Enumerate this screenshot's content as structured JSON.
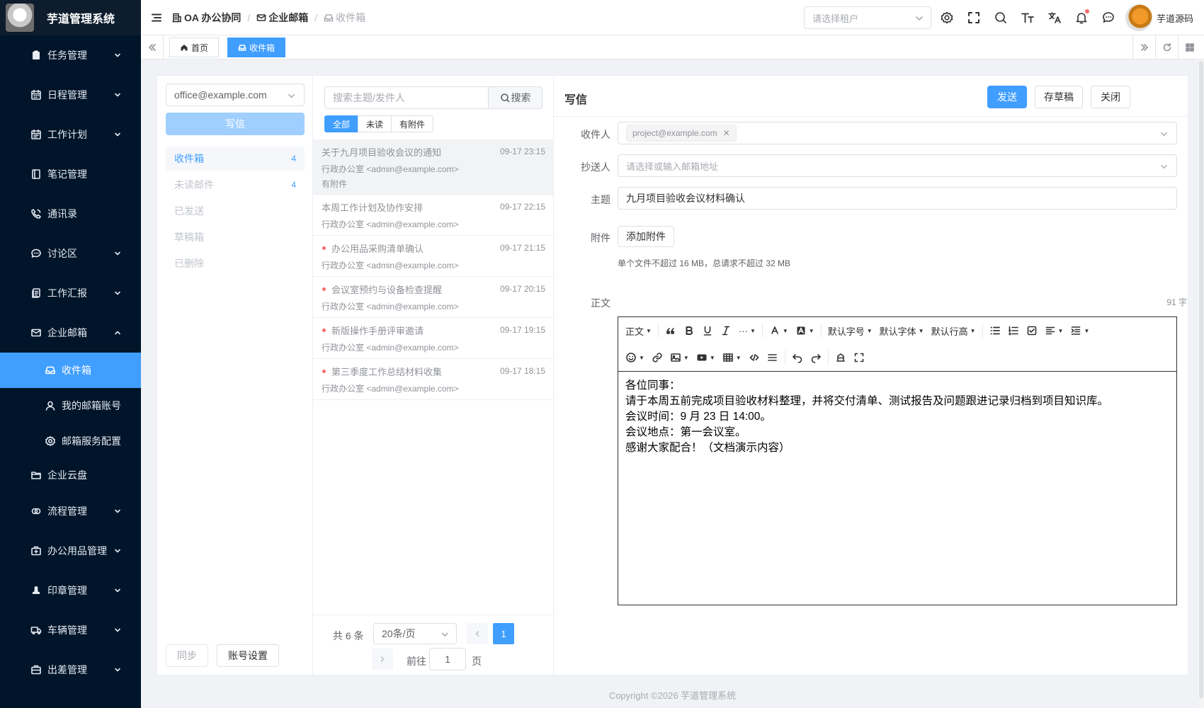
{
  "app": {
    "title": "芋道管理系统"
  },
  "sidebar": {
    "items": [
      {
        "label": "任务管理",
        "icon": "clipboard-icon",
        "expandable": true
      },
      {
        "label": "日程管理",
        "icon": "calendar-icon",
        "expandable": true
      },
      {
        "label": "工作计划",
        "icon": "calendar-plan-icon",
        "expandable": true
      },
      {
        "label": "笔记管理",
        "icon": "notebook-icon",
        "expandable": false
      },
      {
        "label": "通讯录",
        "icon": "phone-icon",
        "expandable": false
      },
      {
        "label": "讨论区",
        "icon": "chat-icon",
        "expandable": true
      },
      {
        "label": "工作汇报",
        "icon": "report-icon",
        "expandable": true
      },
      {
        "label": "企业邮箱",
        "icon": "mail-icon",
        "expandable": true,
        "expanded": true
      }
    ],
    "mail_sub": [
      {
        "label": "收件箱",
        "icon": "inbox-icon",
        "active": true
      },
      {
        "label": "我的邮箱账号",
        "icon": "user-icon"
      },
      {
        "label": "邮箱服务配置",
        "icon": "gear-icon"
      }
    ],
    "items_after": [
      {
        "label": "企业云盘",
        "icon": "folder-icon",
        "expandable": false
      },
      {
        "label": "流程管理",
        "icon": "flow-icon",
        "expandable": true
      },
      {
        "label": "办公用品管理",
        "icon": "briefcase-icon",
        "expandable": true
      },
      {
        "label": "印章管理",
        "icon": "stamp-icon",
        "expandable": true
      },
      {
        "label": "车辆管理",
        "icon": "truck-icon",
        "expandable": true
      },
      {
        "label": "出差管理",
        "icon": "suitcase-icon",
        "expandable": true
      }
    ]
  },
  "header": {
    "breadcrumb": [
      "OA 办公协同",
      "企业邮箱",
      "收件箱"
    ],
    "tenant_placeholder": "请选择租户",
    "username": "芋道源码"
  },
  "tags": {
    "home": "首页",
    "inbox": "收件箱"
  },
  "mail_left": {
    "account": "office@example.com",
    "compose_label": "写信",
    "folders": [
      {
        "label": "收件箱",
        "count": "4",
        "active": true
      },
      {
        "label": "未读邮件",
        "count": "4"
      },
      {
        "label": "已发送",
        "count": ""
      },
      {
        "label": "草稿箱",
        "count": ""
      },
      {
        "label": "已删除",
        "count": ""
      }
    ],
    "sync_label": "同步",
    "account_settings_label": "账号设置"
  },
  "mail_list": {
    "search_placeholder": "搜索主题/发件人",
    "search_button": "搜索",
    "filters": [
      "全部",
      "未读",
      "有附件"
    ],
    "messages": [
      {
        "subject": "关于九月项目验收会议的通知",
        "from": "行政办公室 <admin@example.com>",
        "time": "09-17 23:15",
        "attachment": "有附件",
        "unread": false,
        "selected": true
      },
      {
        "subject": "本周工作计划及协作安排",
        "from": "行政办公室 <admin@example.com>",
        "time": "09-17 22:15",
        "unread": false
      },
      {
        "subject": "办公用品采购清单确认",
        "from": "行政办公室 <admin@example.com>",
        "time": "09-17 21:15",
        "unread": true
      },
      {
        "subject": "会议室预约与设备检查提醒",
        "from": "行政办公室 <admin@example.com>",
        "time": "09-17 20:15",
        "unread": true
      },
      {
        "subject": "新版操作手册评审邀请",
        "from": "行政办公室 <admin@example.com>",
        "time": "09-17 19:15",
        "unread": true
      },
      {
        "subject": "第三季度工作总结材料收集",
        "from": "行政办公室 <admin@example.com>",
        "time": "09-17 18:15",
        "unread": true
      }
    ],
    "pager": {
      "total": "共 6 条",
      "page_size": "20条/页",
      "current": "1",
      "goto_label": "前往",
      "goto_value": "1",
      "page_suffix": "页"
    }
  },
  "compose": {
    "title": "写信",
    "send_label": "发送",
    "draft_label": "存草稿",
    "close_label": "关闭",
    "to_label": "收件人",
    "to_chip": "project@example.com",
    "cc_label": "抄送人",
    "cc_placeholder": "请选择或输入邮箱地址",
    "subject_label": "主题",
    "subject_value": "九月项目验收会议材料确认",
    "attach_label": "附件",
    "attach_button": "添加附件",
    "attach_hint": "单个文件不超过 16 MB，总请求不超过 32 MB",
    "body_label": "正文",
    "word_count": "91 字",
    "toolbar": {
      "paragraph": "正文",
      "font_size": "默认字号",
      "font_family": "默认字体",
      "line_height": "默认行高"
    },
    "body_lines": [
      "各位同事：",
      "请于本周五前完成项目验收材料整理，并将交付清单、测试报告及问题跟进记录归档到项目知识库。",
      "会议时间：9 月 23 日 14:00。",
      "会议地点：第一会议室。",
      "感谢大家配合！（文档演示内容）"
    ]
  },
  "footer": {
    "copyright": "Copyright ©2026 芋道管理系统"
  },
  "colors": {
    "primary": "#409eff",
    "sidebar_bg": "#001529",
    "unread_dot": "#f56c6c"
  }
}
